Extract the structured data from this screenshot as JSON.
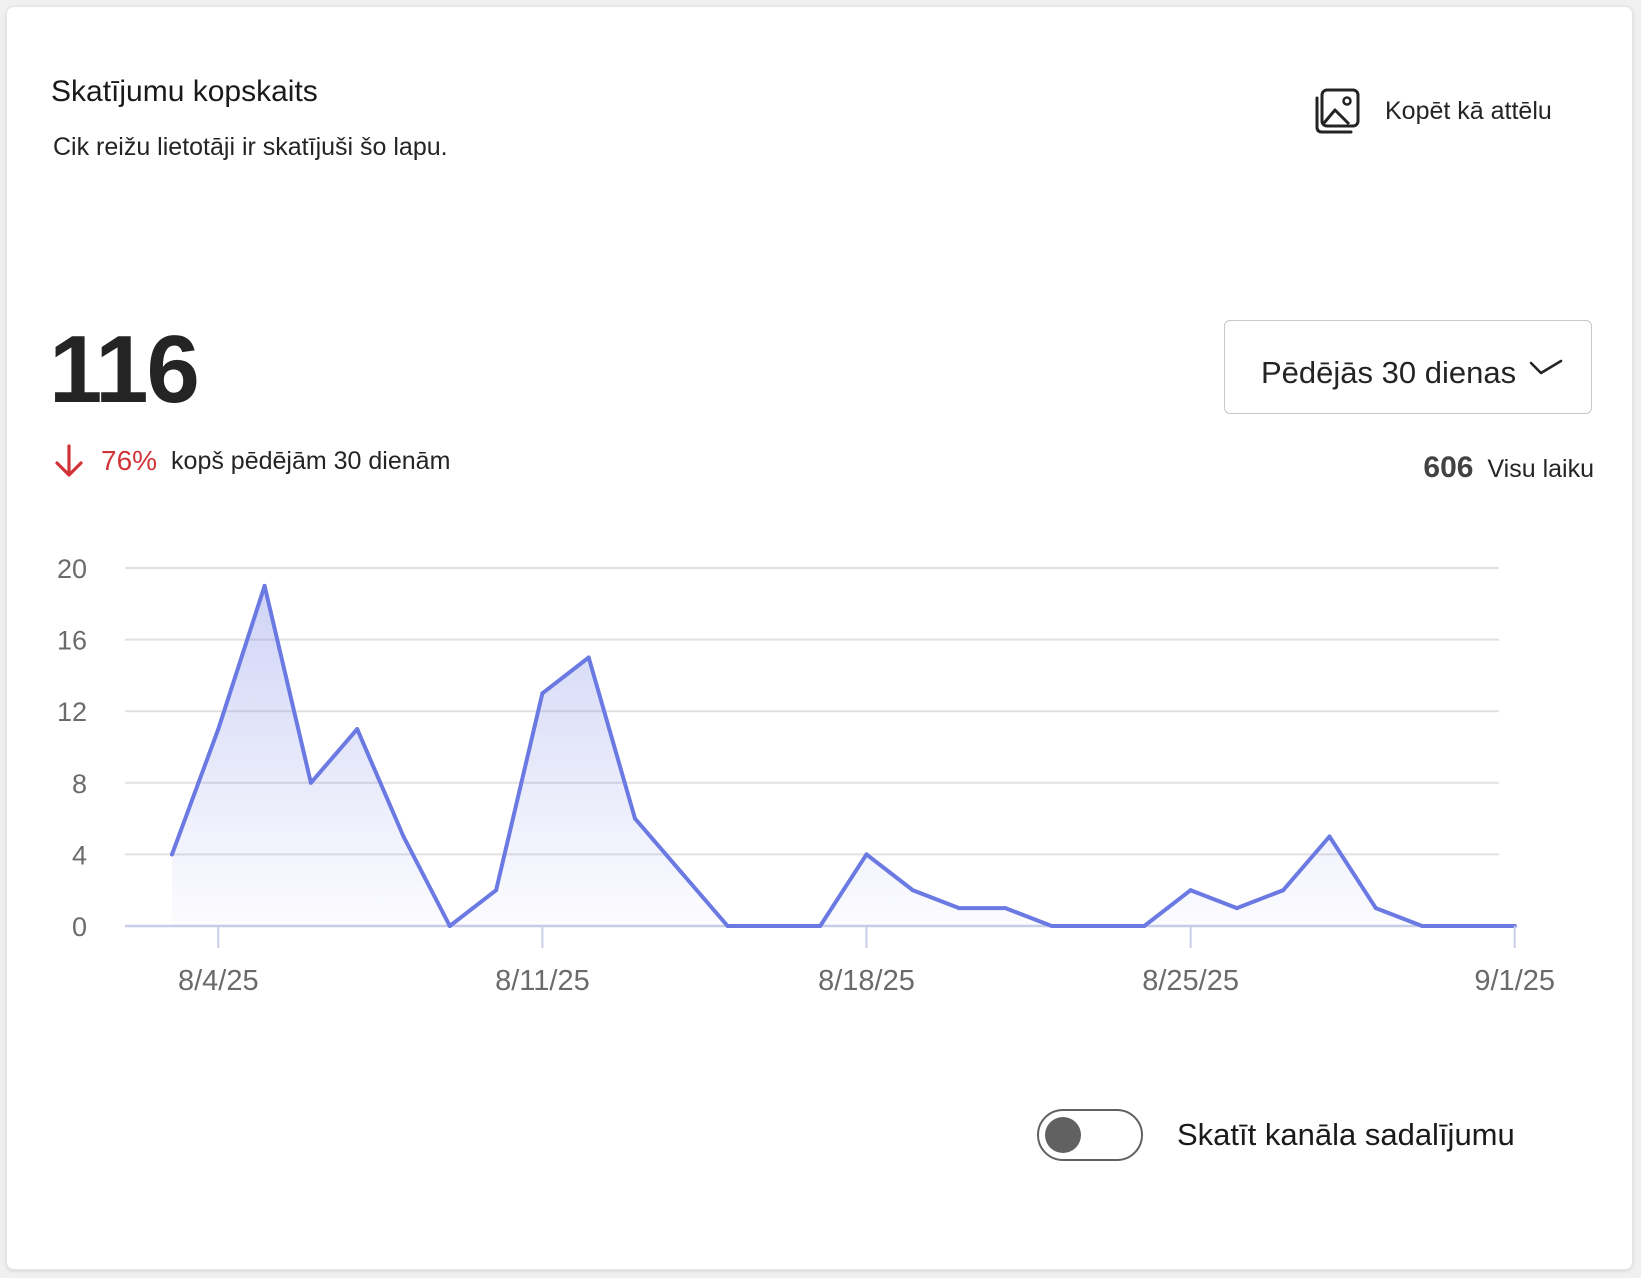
{
  "header": {
    "title": "Skatījumu kopskaits",
    "subtitle": "Cik reižu lietotāji ir skatījuši šo lapu."
  },
  "copy_button": {
    "label": "Kopēt kā attēlu",
    "icon": "image-copy-icon"
  },
  "summary": {
    "total": "116",
    "trend_direction": "down",
    "trend_icon": "arrow-down-icon",
    "trend_percent": "76%",
    "trend_text": "kopš pēdējām 30 dienām",
    "trend_color": "#d13438"
  },
  "range_select": {
    "value": "Pēdējās 30 dienas",
    "icon": "chevron-down-icon"
  },
  "all_time": {
    "value": "606",
    "label": "Visu laiku"
  },
  "toggle": {
    "label": "Skatīt kanāla sadalījumu",
    "state": "off"
  },
  "colors": {
    "line": "#6b79e3",
    "grid": "#e1e1e1",
    "axis": "#c8cde8"
  },
  "chart_data": {
    "type": "area",
    "title": "",
    "xlabel": "",
    "ylabel": "",
    "x": [
      "2025-08-03",
      "2025-08-04",
      "2025-08-05",
      "2025-08-06",
      "2025-08-07",
      "2025-08-08",
      "2025-08-09",
      "2025-08-10",
      "2025-08-11",
      "2025-08-12",
      "2025-08-13",
      "2025-08-14",
      "2025-08-15",
      "2025-08-16",
      "2025-08-17",
      "2025-08-18",
      "2025-08-19",
      "2025-08-20",
      "2025-08-21",
      "2025-08-22",
      "2025-08-23",
      "2025-08-24",
      "2025-08-25",
      "2025-08-26",
      "2025-08-27",
      "2025-08-28",
      "2025-08-29",
      "2025-08-30",
      "2025-08-31",
      "2025-09-01"
    ],
    "series": [
      {
        "values": [
          4,
          11,
          19,
          8,
          11,
          5,
          0,
          2,
          13,
          15,
          6,
          3,
          0,
          0,
          0,
          4,
          2,
          1,
          1,
          0,
          0,
          0,
          2,
          1,
          2,
          5,
          1,
          0,
          0,
          0
        ]
      }
    ],
    "x_tick_labels": [
      "8/4/25",
      "8/11/25",
      "8/18/25",
      "8/25/25",
      "9/1/25"
    ],
    "y_ticks": [
      "0",
      "4",
      "8",
      "12",
      "16",
      "20"
    ],
    "ylim": [
      0,
      20
    ],
    "grid": true,
    "legend": "none"
  }
}
